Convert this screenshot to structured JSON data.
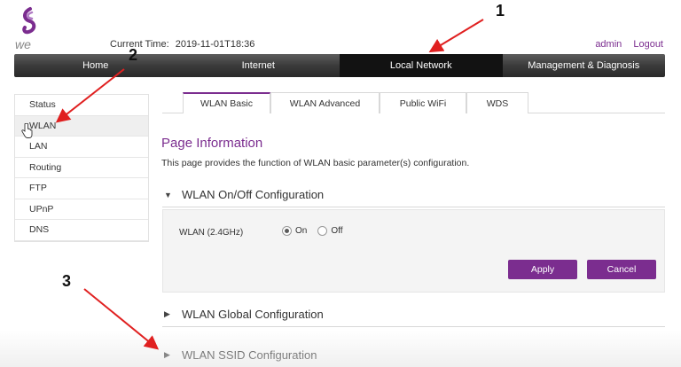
{
  "header": {
    "logo_text": "we",
    "current_time_label": "Current Time:",
    "current_time_value": "2019-11-01T18:36",
    "user": "admin",
    "logout": "Logout"
  },
  "nav": [
    {
      "label": "Home"
    },
    {
      "label": "Internet"
    },
    {
      "label": "Local Network",
      "active": true
    },
    {
      "label": "Management & Diagnosis"
    }
  ],
  "sidebar": {
    "items": [
      {
        "label": "Status"
      },
      {
        "label": "WLAN",
        "active": true
      },
      {
        "label": "LAN"
      },
      {
        "label": "Routing"
      },
      {
        "label": "FTP"
      },
      {
        "label": "UPnP"
      },
      {
        "label": "DNS"
      }
    ]
  },
  "tabs": [
    {
      "label": "WLAN Basic",
      "active": true
    },
    {
      "label": "WLAN Advanced"
    },
    {
      "label": "Public WiFi"
    },
    {
      "label": "WDS"
    }
  ],
  "page_info": {
    "title": "Page Information",
    "description": "This page provides the function of WLAN basic parameter(s) configuration."
  },
  "sections": {
    "onoff": {
      "title": "WLAN On/Off Configuration",
      "expanded": true
    },
    "global": {
      "title": "WLAN Global Configuration"
    },
    "ssid": {
      "title": "WLAN SSID Configuration"
    }
  },
  "wlan_onoff": {
    "label": "WLAN (2.4GHz)",
    "option_on": "On",
    "option_off": "Off",
    "selected": "On",
    "apply": "Apply",
    "cancel": "Cancel"
  },
  "annotations": {
    "n1": "1",
    "n2": "2",
    "n3": "3"
  },
  "colors": {
    "accent": "#7b2d8f",
    "annotation_arrow": "#e02020",
    "nav_bg": "#3b3b3b"
  },
  "icons": {
    "expanded": "triangle-down-icon",
    "collapsed": "triangle-right-icon",
    "cursor": "hand-pointer-icon"
  }
}
